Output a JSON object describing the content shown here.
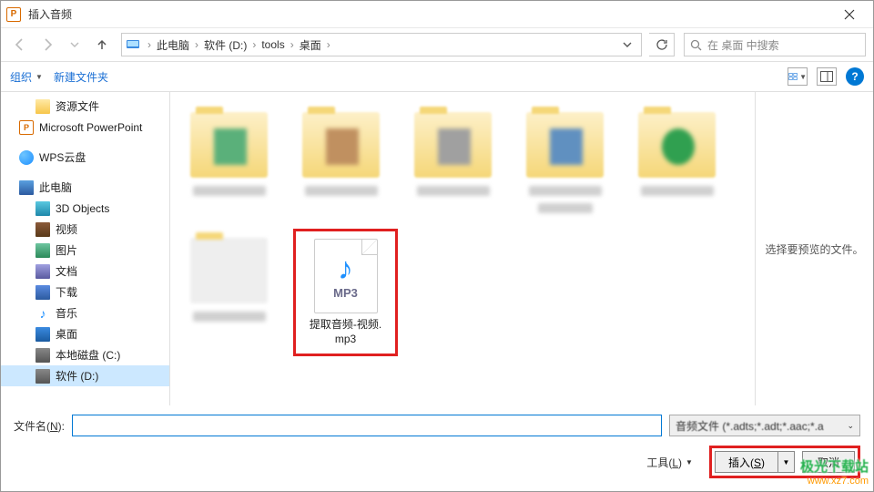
{
  "title": "插入音频",
  "breadcrumbs": [
    "此电脑",
    "软件 (D:)",
    "tools",
    "桌面"
  ],
  "search_placeholder": "在 桌面 中搜索",
  "toolbar": {
    "organize": "组织",
    "newfolder": "新建文件夹"
  },
  "tree": {
    "res": "资源文件",
    "ppt": "Microsoft PowerPoint",
    "wps": "WPS云盘",
    "pc": "此电脑",
    "obj": "3D Objects",
    "vid": "视频",
    "pic": "图片",
    "doc": "文档",
    "dl": "下载",
    "mus": "音乐",
    "desk": "桌面",
    "cdrv": "本地磁盘 (C:)",
    "ddrv": "软件 (D:)"
  },
  "mp3": {
    "badge": "MP3",
    "name1": "提取音频-视频.",
    "name2": "mp3"
  },
  "preview_hint": "选择要预览的文件。",
  "filename_label": "文件名(N):",
  "filetype": "音频文件 (*.adts;*.adt;*.aac;*.a",
  "tools_label": "工具(L)",
  "insert_label": "插入(S)",
  "cancel_label": "取消",
  "watermark": {
    "l1": "极光下载站",
    "l2": "www.xz7.com"
  }
}
